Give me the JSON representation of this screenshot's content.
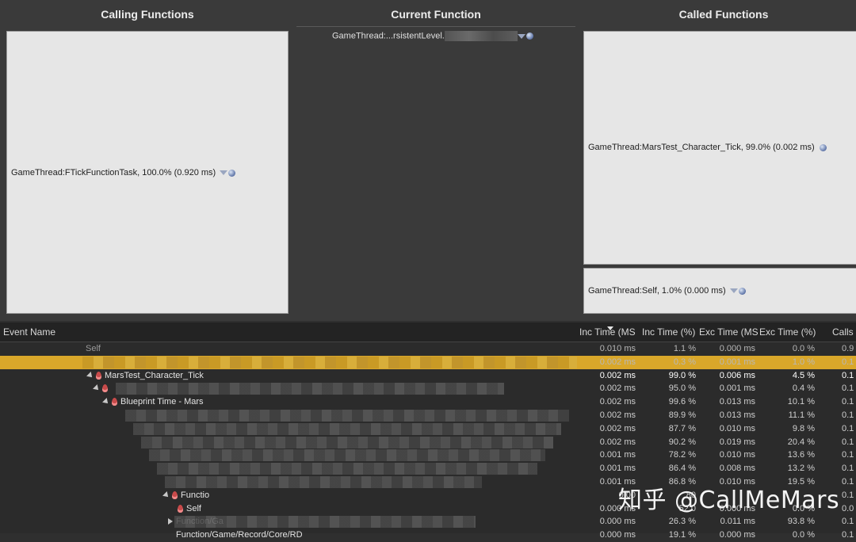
{
  "panels": {
    "calling": {
      "title": "Calling Functions",
      "items": [
        {
          "label": "GameThread:FTickFunctionTask, 100.0% (0.920 ms)"
        }
      ]
    },
    "current": {
      "title": "Current Function",
      "label": "GameThread:...rsistentLevel."
    },
    "called": {
      "title": "Called Functions",
      "items": [
        {
          "label": "GameThread:MarsTest_Character_Tick, 99.0% (0.002 ms)"
        },
        {
          "label": "GameThread:Self, 1.0% (0.000 ms)"
        }
      ]
    }
  },
  "table": {
    "headers": {
      "event_name": "Event Name",
      "inc_time_ms": "Inc Time (MS",
      "inc_time_pct": "Inc Time (%)",
      "exc_time_ms": "Exc Time (MS",
      "exc_time_pct": "Exc Time (%)",
      "calls": "Calls"
    },
    "rows": [
      {
        "name": "Self",
        "inc_ms": "0.010 ms",
        "inc_pct": "1.1 %",
        "exc_ms": "0.000 ms",
        "exc_pct": "0.0 %",
        "calls": "0.9"
      },
      {
        "name": "",
        "inc_ms": "0.002 ms",
        "inc_pct": "0.3 %",
        "exc_ms": "0.001 ms",
        "exc_pct": "1.0 %",
        "calls": "0.1"
      },
      {
        "name": "MarsTest_Character_Tick",
        "inc_ms": "0.002 ms",
        "inc_pct": "99.0 %",
        "exc_ms": "0.006 ms",
        "exc_pct": "4.5 %",
        "calls": "0.1"
      },
      {
        "name": "",
        "inc_ms": "0.002 ms",
        "inc_pct": "95.0 %",
        "exc_ms": "0.001 ms",
        "exc_pct": "0.4 %",
        "calls": "0.1"
      },
      {
        "name": "Blueprint Time - Mars",
        "inc_ms": "0.002 ms",
        "inc_pct": "99.6 %",
        "exc_ms": "0.013 ms",
        "exc_pct": "10.1 %",
        "calls": "0.1"
      },
      {
        "name": "",
        "inc_ms": "0.002 ms",
        "inc_pct": "89.9 %",
        "exc_ms": "0.013 ms",
        "exc_pct": "11.1 %",
        "calls": "0.1"
      },
      {
        "name": "",
        "inc_ms": "0.002 ms",
        "inc_pct": "87.7 %",
        "exc_ms": "0.010 ms",
        "exc_pct": "9.8 %",
        "calls": "0.1"
      },
      {
        "name": "",
        "inc_ms": "0.002 ms",
        "inc_pct": "90.2 %",
        "exc_ms": "0.019 ms",
        "exc_pct": "20.4 %",
        "calls": "0.1"
      },
      {
        "name": "",
        "inc_ms": "0.001 ms",
        "inc_pct": "78.2 %",
        "exc_ms": "0.010 ms",
        "exc_pct": "13.6 %",
        "calls": "0.1"
      },
      {
        "name": "",
        "inc_ms": "0.001 ms",
        "inc_pct": "86.4 %",
        "exc_ms": "0.008 ms",
        "exc_pct": "13.2 %",
        "calls": "0.1"
      },
      {
        "name": "",
        "inc_ms": "0.001 ms",
        "inc_pct": "86.8 %",
        "exc_ms": "0.010 ms",
        "exc_pct": "19.5 %",
        "calls": "0.1"
      },
      {
        "name": "Functio",
        "inc_ms": "0.00",
        "inc_pct": "80",
        "exc_ms": "",
        "exc_pct": "",
        "calls": "0.1"
      },
      {
        "name": "Self",
        "inc_ms": "0.000 ms",
        "inc_pct": "52.0",
        "exc_ms": "0.000 ms",
        "exc_pct": "0.0 %",
        "calls": "0.0"
      },
      {
        "name": "Function/Ga",
        "inc_ms": "0.000 ms",
        "inc_pct": "26.3 %",
        "exc_ms": "0.011 ms",
        "exc_pct": "93.8 %",
        "calls": "0.1"
      },
      {
        "name": "Function/Game/Record/Core/RD",
        "inc_ms": "0.000 ms",
        "inc_pct": "19.1 %",
        "exc_ms": "0.000 ms",
        "exc_pct": "0.0 %",
        "calls": "0.1"
      }
    ]
  },
  "watermark": "知乎 @CallMeMars",
  "colors": {
    "selected_row": "#d9a72a",
    "panel_box": "#e6e6e6",
    "background": "#2f2f2f"
  }
}
